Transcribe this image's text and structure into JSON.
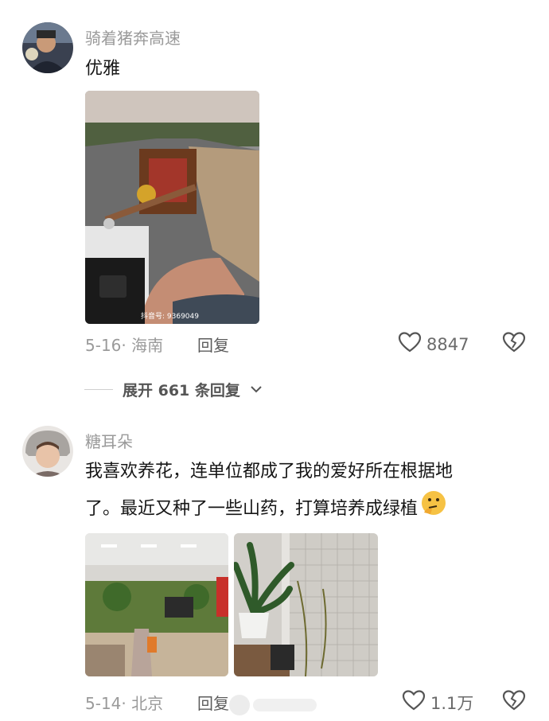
{
  "comments": [
    {
      "username": "骑着猪奔高速",
      "text_lines": [
        "优雅"
      ],
      "date_location": "5-16· 海南",
      "reply_label": "回复",
      "like_count": "8847",
      "photo_watermark": "抖音号: 9369049"
    },
    {
      "username": "糖耳朵",
      "text_lines": [
        "我喜欢养花，连单位都成了我的爱好所在根据地",
        "了。最近又种了一些山药，打算培养成绿植"
      ],
      "emoji": "thinking-face",
      "date_location": "5-14· 北京",
      "reply_label": "回复",
      "like_count": "1.1万"
    }
  ],
  "expand_replies_label": "展开 661 条回复",
  "icons": {
    "like": "heart-outline-icon",
    "dislike": "broken-heart-icon",
    "expand": "chevron-down-icon"
  },
  "colors": {
    "username": "#9a9a9a",
    "text": "#161616",
    "meta": "#9a9a9a"
  }
}
